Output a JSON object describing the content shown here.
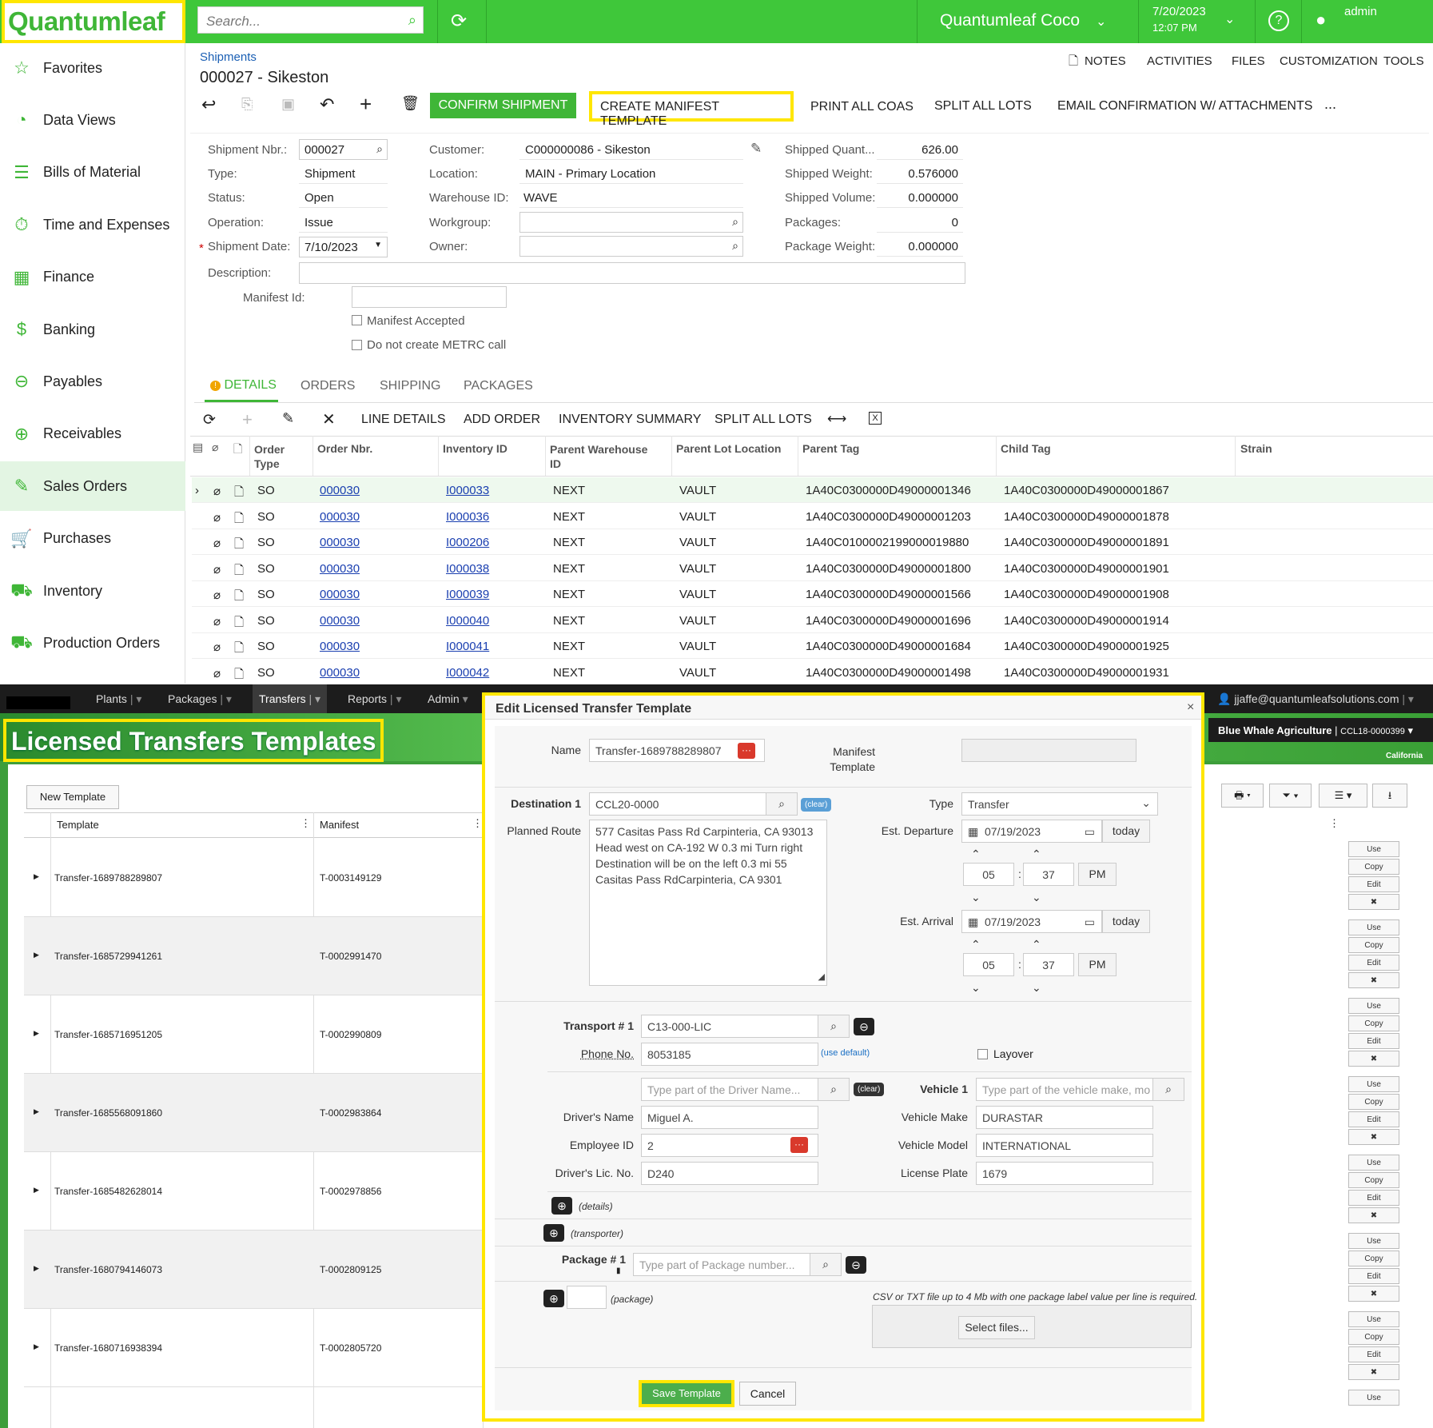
{
  "top": {
    "logo": "Quantumleaf",
    "search_placeholder": "Search...",
    "company": "Quantumleaf Coco",
    "date": "7/20/2023",
    "time": "12:07 PM",
    "user": "admin",
    "sidebar": [
      {
        "label": "Favorites",
        "icon": "star-icon"
      },
      {
        "label": "Data Views",
        "icon": "pie-chart-icon"
      },
      {
        "label": "Bills of Material",
        "icon": "list-icon"
      },
      {
        "label": "Time and Expenses",
        "icon": "timer-icon"
      },
      {
        "label": "Finance",
        "icon": "calculator-icon"
      },
      {
        "label": "Banking",
        "icon": "dollar-icon"
      },
      {
        "label": "Payables",
        "icon": "minus-circle-icon"
      },
      {
        "label": "Receivables",
        "icon": "plus-circle-icon"
      },
      {
        "label": "Sales Orders",
        "icon": "edit-icon"
      },
      {
        "label": "Purchases",
        "icon": "cart-icon"
      },
      {
        "label": "Inventory",
        "icon": "truck-icon"
      },
      {
        "label": "Production Orders",
        "icon": "truck-icon"
      }
    ],
    "breadcrumb": "Shipments",
    "title": "000027 - Sikeston",
    "header_links": [
      "NOTES",
      "ACTIVITIES",
      "FILES",
      "CUSTOMIZATION",
      "TOOLS"
    ],
    "actions": {
      "confirm": "CONFIRM SHIPMENT",
      "manifest": "CREATE MANIFEST TEMPLATE",
      "coas": "PRINT ALL COAS",
      "split": "SPLIT ALL LOTS",
      "email": "EMAIL CONFIRMATION W/ ATTACHMENTS",
      "more": "..."
    },
    "form": {
      "shipment_nbr_l": "Shipment Nbr.:",
      "shipment_nbr": "000027",
      "type_l": "Type:",
      "type": "Shipment",
      "status_l": "Status:",
      "status": "Open",
      "operation_l": "Operation:",
      "operation": "Issue",
      "ship_date_l": "Shipment Date:",
      "ship_date": "7/10/2023",
      "description_l": "Description:",
      "customer_l": "Customer:",
      "customer": "C000000086 - Sikeston",
      "location_l": "Location:",
      "location": "MAIN - Primary Location",
      "warehouse_l": "Warehouse ID:",
      "warehouse": "WAVE",
      "workgroup_l": "Workgroup:",
      "owner_l": "Owner:",
      "shipped_qty_l": "Shipped Quant...",
      "shipped_qty": "626.00",
      "shipped_wt_l": "Shipped Weight:",
      "shipped_wt": "0.576000",
      "shipped_vol_l": "Shipped Volume:",
      "shipped_vol": "0.000000",
      "packages_l": "Packages:",
      "packages": "0",
      "pkg_wt_l": "Package Weight:",
      "pkg_wt": "0.000000",
      "manifest_id_l": "Manifest Id:",
      "manifest_accepted": "Manifest Accepted",
      "no_metrc": "Do not create METRC call"
    },
    "tabs": [
      "DETAILS",
      "ORDERS",
      "SHIPPING",
      "PACKAGES"
    ],
    "grid_tools": [
      "LINE DETAILS",
      "ADD ORDER",
      "INVENTORY SUMMARY",
      "SPLIT ALL LOTS"
    ],
    "columns": {
      "order_type": "Order",
      "order_type2": "Type",
      "order_nbr": "Order Nbr.",
      "inventory": "Inventory ID",
      "parent_wh": "Parent Warehouse",
      "parent_wh2": "ID",
      "parent_lot": "Parent Lot Location",
      "parent_tag": "Parent Tag",
      "child_tag": "Child Tag",
      "strain": "Strain"
    },
    "rows": [
      {
        "type": "SO",
        "order": "000030",
        "inv": "I000033",
        "wh": "NEXT",
        "lot": "VAULT",
        "ptag": "1A40C0300000D49000001346",
        "ctag": "1A40C0300000D49000001867"
      },
      {
        "type": "SO",
        "order": "000030",
        "inv": "I000036",
        "wh": "NEXT",
        "lot": "VAULT",
        "ptag": "1A40C0300000D49000001203",
        "ctag": "1A40C0300000D49000001878"
      },
      {
        "type": "SO",
        "order": "000030",
        "inv": "I000206",
        "wh": "NEXT",
        "lot": "VAULT",
        "ptag": "1A40C0100002199000019880",
        "ctag": "1A40C0300000D49000001891"
      },
      {
        "type": "SO",
        "order": "000030",
        "inv": "I000038",
        "wh": "NEXT",
        "lot": "VAULT",
        "ptag": "1A40C0300000D49000001800",
        "ctag": "1A40C0300000D49000001901"
      },
      {
        "type": "SO",
        "order": "000030",
        "inv": "I000039",
        "wh": "NEXT",
        "lot": "VAULT",
        "ptag": "1A40C0300000D49000001566",
        "ctag": "1A40C0300000D49000001908"
      },
      {
        "type": "SO",
        "order": "000030",
        "inv": "I000040",
        "wh": "NEXT",
        "lot": "VAULT",
        "ptag": "1A40C0300000D49000001696",
        "ctag": "1A40C0300000D49000001914"
      },
      {
        "type": "SO",
        "order": "000030",
        "inv": "I000041",
        "wh": "NEXT",
        "lot": "VAULT",
        "ptag": "1A40C0300000D49000001684",
        "ctag": "1A40C0300000D49000001925"
      },
      {
        "type": "SO",
        "order": "000030",
        "inv": "I000042",
        "wh": "NEXT",
        "lot": "VAULT",
        "ptag": "1A40C0300000D49000001498",
        "ctag": "1A40C0300000D49000001931"
      }
    ]
  },
  "metrc": {
    "nav": [
      "Plants",
      "Packages",
      "Transfers",
      "Reports",
      "Admin"
    ],
    "user_email": "jjaffe@quantumleafsolutions.com",
    "banner_title": "Licensed Transfers Templates",
    "facility": "Blue Whale Agriculture",
    "license": "CCL18-0000399",
    "state": "California",
    "new_template": "New Template",
    "col_template": "Template",
    "col_manifest": "Manifest",
    "templates": [
      {
        "name": "Transfer-1689788289807",
        "manifest": "T-0003149129"
      },
      {
        "name": "Transfer-1685729941261",
        "manifest": "T-0002991470"
      },
      {
        "name": "Transfer-1685716951205",
        "manifest": "T-0002990809"
      },
      {
        "name": "Transfer-1685568091860",
        "manifest": "T-0002983864"
      },
      {
        "name": "Transfer-1685482628014",
        "manifest": "T-0002978856"
      },
      {
        "name": "Transfer-1680794146073",
        "manifest": "T-0002809125"
      },
      {
        "name": "Transfer-1680716938394",
        "manifest": "T-0002805720"
      }
    ],
    "row_actions": [
      "Use",
      "Copy",
      "Edit",
      "✖"
    ],
    "modal": {
      "title": "Edit Licensed Transfer Template",
      "name_l": "Name",
      "name": "Transfer-1689788289807",
      "manifest_l1": "Manifest",
      "manifest_l2": "Template",
      "dest_l": "Destination 1",
      "dest": "CCL20-0000",
      "clear": "(clear)",
      "type_l": "Type",
      "type": "Transfer",
      "route_l": "Planned Route",
      "route": "577 Casitas Pass Rd Carpinteria, CA 93013 Head west on CA-192 W 0.3 mi Turn right Destination will be on the left 0.3 mi 55 Casitas Pass RdCarpinteria, CA 9301",
      "est_dep_l": "Est. Departure",
      "est_dep": "07/19/2023",
      "today": "today",
      "dep_h": "05",
      "dep_m": "37",
      "dep_ampm": "PM",
      "est_arr_l": "Est. Arrival",
      "est_arr": "07/19/2023",
      "arr_h": "05",
      "arr_m": "37",
      "arr_ampm": "PM",
      "transport_l": "Transport # 1",
      "transport": "C13-000-LIC",
      "phone_l": "Phone No.",
      "phone": "8053185",
      "use_default": "(use default)",
      "layover": "Layover",
      "driver_search_ph": "Type part of the Driver Name...",
      "vehicle_l": "Vehicle 1",
      "vehicle_search_ph": "Type part of the vehicle make, mo",
      "driver_name_l": "Driver's Name",
      "driver_name": "Miguel A.",
      "vehicle_make_l": "Vehicle Make",
      "vehicle_make": "DURASTAR",
      "emp_id_l": "Employee ID",
      "emp_id": "2",
      "vehicle_model_l": "Vehicle Model",
      "vehicle_model": "INTERNATIONAL",
      "lic_l": "Driver's Lic. No.",
      "lic": "D240",
      "plate_l": "License Plate",
      "plate": "1679",
      "details": "(details)",
      "transporter": "(transporter)",
      "package_l": "Package # 1",
      "package_ph": "Type part of Package number...",
      "package_note": "(package)",
      "file_note": "CSV or TXT file up to 4 Mb with one package label value per line is required.",
      "select_files": "Select files...",
      "save": "Save Template",
      "cancel": "Cancel"
    }
  },
  "colors": {
    "brand_green": "#3fc73a",
    "highlight": "#ffe600",
    "metrc_green": "#3d9e3a"
  }
}
